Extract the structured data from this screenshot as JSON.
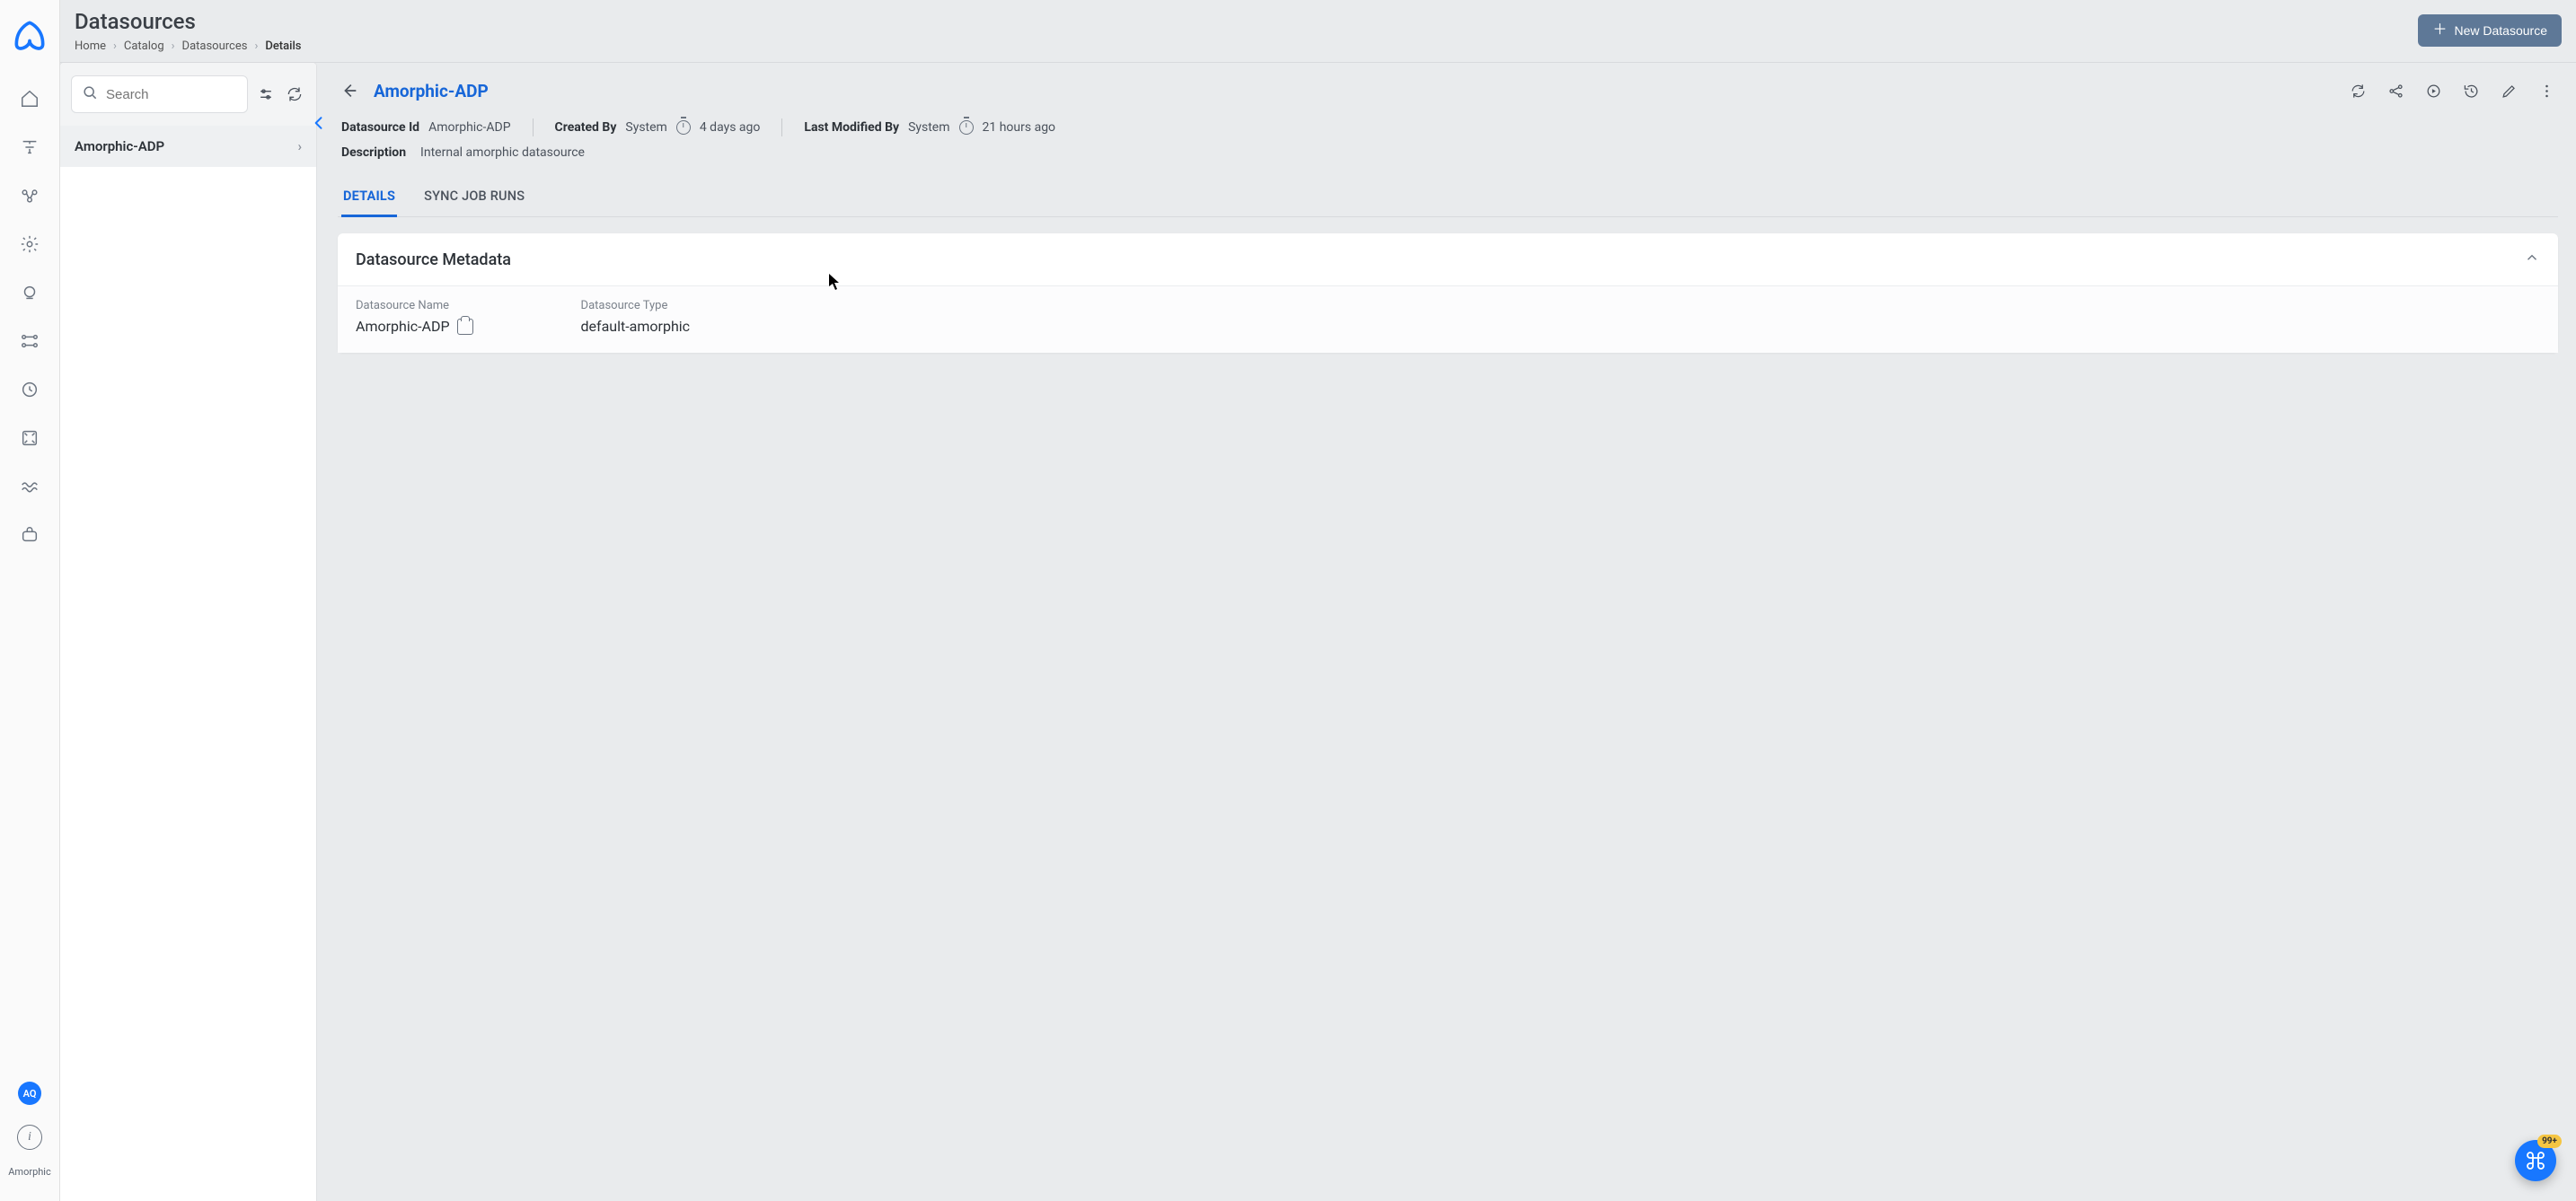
{
  "brand_short": "Amorphic",
  "avatar_initials": "AQ",
  "header": {
    "title": "Datasources",
    "breadcrumb": [
      "Home",
      "Catalog",
      "Datasources",
      "Details"
    ],
    "new_button": "New Datasource"
  },
  "panel": {
    "search_placeholder": "Search",
    "items": [
      {
        "label": "Amorphic-ADP"
      }
    ]
  },
  "detail": {
    "title": "Amorphic-ADP",
    "id_label": "Datasource Id",
    "id_value": "Amorphic-ADP",
    "created_label": "Created By",
    "created_by": "System",
    "created_ago": "4 days ago",
    "modified_label": "Last Modified By",
    "modified_by": "System",
    "modified_ago": "21 hours ago",
    "description_label": "Description",
    "description_value": "Internal amorphic datasource",
    "tabs": [
      "DETAILS",
      "SYNC JOB RUNS"
    ],
    "active_tab": 0,
    "card": {
      "title": "Datasource Metadata",
      "fields": [
        {
          "label": "Datasource Name",
          "value": "Amorphic-ADP",
          "copy": true
        },
        {
          "label": "Datasource Type",
          "value": "default-amorphic",
          "copy": false
        }
      ]
    }
  },
  "fab_badge": "99+"
}
